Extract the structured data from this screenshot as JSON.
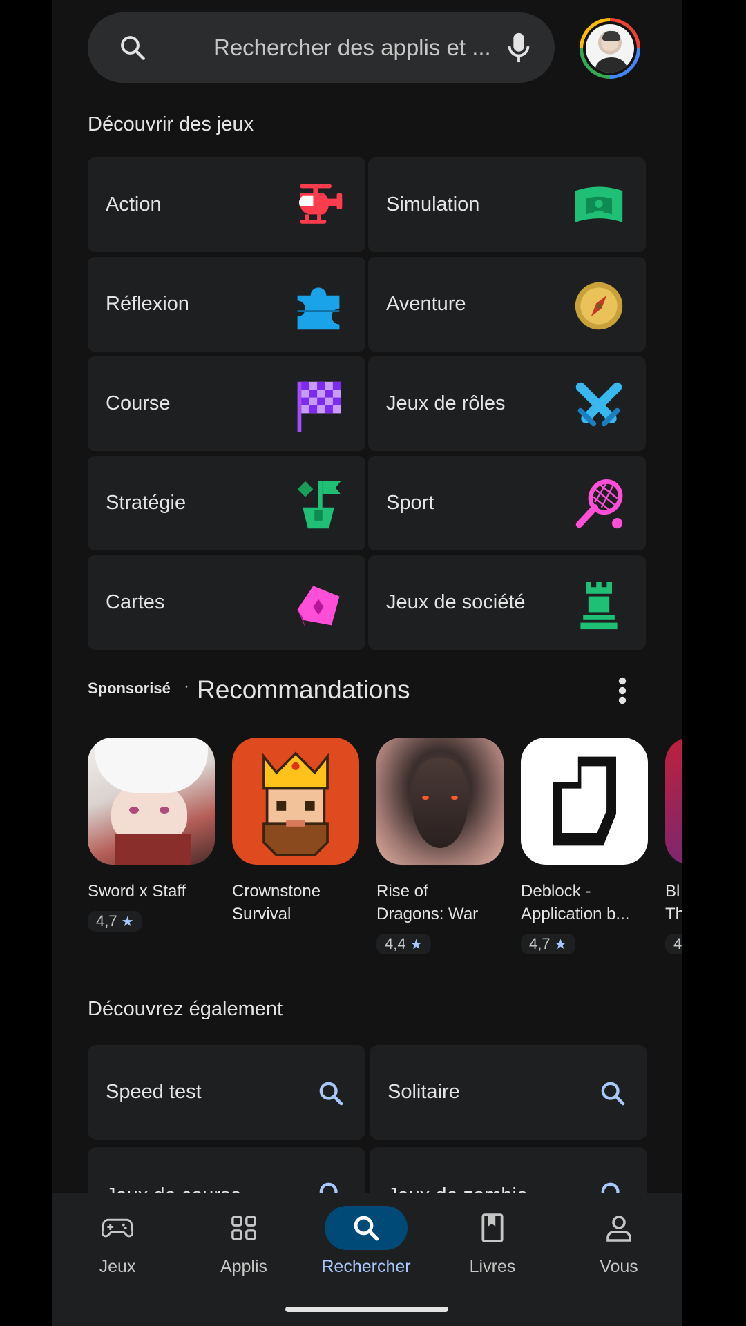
{
  "search": {
    "placeholder": "Rechercher des applis et ..."
  },
  "games_section": {
    "title": "Découvrir des jeux",
    "categories": [
      {
        "label": "Action",
        "icon": "helicopter-icon"
      },
      {
        "label": "Simulation",
        "icon": "stadium-icon"
      },
      {
        "label": "Réflexion",
        "icon": "puzzle-icon"
      },
      {
        "label": "Aventure",
        "icon": "compass-icon"
      },
      {
        "label": "Course",
        "icon": "checkered-flag-icon"
      },
      {
        "label": "Jeux de rôles",
        "icon": "crossed-swords-icon"
      },
      {
        "label": "Stratégie",
        "icon": "strategy-flag-icon"
      },
      {
        "label": "Sport",
        "icon": "tennis-racket-icon"
      },
      {
        "label": "Cartes",
        "icon": "card-icon"
      },
      {
        "label": "Jeux de société",
        "icon": "chess-rook-icon"
      }
    ]
  },
  "recommendations": {
    "sponsored": "Sponsorisé",
    "separator": "·",
    "title": "Recommandations",
    "apps": [
      {
        "name_line1": "Sword x Staff",
        "name_line2": "",
        "rating": "4,7"
      },
      {
        "name_line1": "Crownstone",
        "name_line2": "Survival",
        "rating": ""
      },
      {
        "name_line1": "Rise of",
        "name_line2": "Dragons: War",
        "rating": "4,4"
      },
      {
        "name_line1": "Deblock -",
        "name_line2": "Application b...",
        "rating": "4,7"
      },
      {
        "name_line1": "Bl",
        "name_line2": "Th",
        "rating": "4"
      }
    ]
  },
  "discover_section": {
    "title": "Découvrez également",
    "items": [
      {
        "label": "Speed test"
      },
      {
        "label": "Solitaire"
      },
      {
        "label": "Jeux de course"
      },
      {
        "label": "Jeux de zombie"
      }
    ]
  },
  "nav": {
    "items": [
      {
        "label": "Jeux",
        "icon": "gamepad-icon"
      },
      {
        "label": "Applis",
        "icon": "apps-grid-icon"
      },
      {
        "label": "Rechercher",
        "icon": "search-icon",
        "active": true
      },
      {
        "label": "Livres",
        "icon": "book-icon"
      },
      {
        "label": "Vous",
        "icon": "person-icon"
      }
    ]
  },
  "colors": {
    "background": "#131314",
    "surface": "#1e1f20",
    "accent": "#a8c7fa",
    "active_pill": "#004a77"
  }
}
